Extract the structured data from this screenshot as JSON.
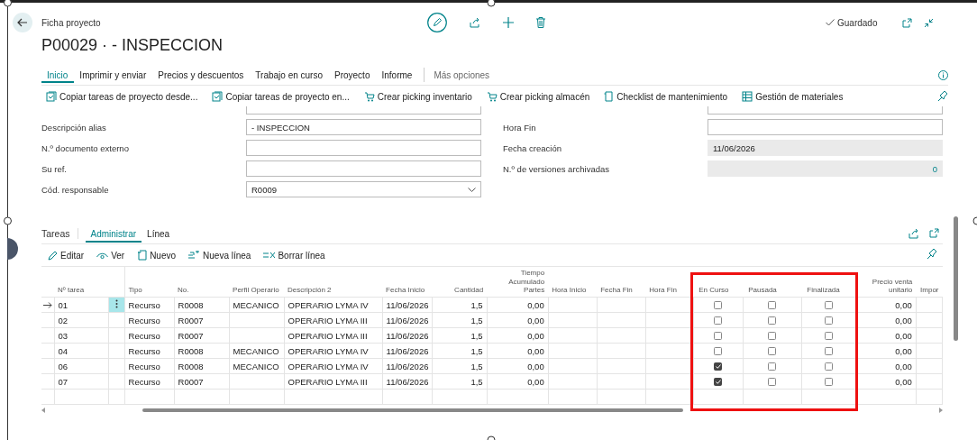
{
  "header": {
    "breadcrumb": "Ficha proyecto",
    "title": "P00029 · - INSPECCION",
    "status": "Guardado"
  },
  "menu": {
    "tabs": [
      {
        "label": "Inicio",
        "selected": true
      },
      {
        "label": "Imprimir y enviar",
        "selected": false
      },
      {
        "label": "Precios y descuentos",
        "selected": false
      },
      {
        "label": "Trabajo en curso",
        "selected": false
      },
      {
        "label": "Proyecto",
        "selected": false
      },
      {
        "label": "Informe",
        "selected": false
      }
    ],
    "more": "Más opciones"
  },
  "actions": [
    {
      "label": "Copiar tareas de proyecto desde...",
      "kind": "copy"
    },
    {
      "label": "Copiar tareas de proyecto en...",
      "kind": "copy"
    },
    {
      "label": "Crear picking inventario",
      "kind": "picking"
    },
    {
      "label": "Crear picking almacén",
      "kind": "picking"
    },
    {
      "label": "Checklist de mantenimiento",
      "kind": "doc"
    },
    {
      "label": "Gestión de materiales",
      "kind": "grid"
    }
  ],
  "fields_left": [
    {
      "label": "Descripción alias",
      "kind": "text",
      "value": "- INSPECCION"
    },
    {
      "label": "N.º documento externo",
      "kind": "text"
    },
    {
      "label": "Su ref.",
      "kind": "text"
    },
    {
      "label": "Cód. responsable",
      "kind": "dropdown",
      "value": "R0009"
    }
  ],
  "fields_right": [
    {
      "label": "Hora Fin",
      "kind": "text"
    },
    {
      "label": "Fecha creación",
      "kind": "readonly",
      "value": "11/06/2026"
    },
    {
      "label": "N.º de versiones archivadas",
      "kind": "readonly-number",
      "value": "0"
    }
  ],
  "tasks": {
    "title": "Tareas",
    "tabs": [
      {
        "label": "Administrar",
        "selected": true
      },
      {
        "label": "Línea",
        "selected": false
      }
    ],
    "actions": [
      {
        "label": "Editar",
        "kind": "edit"
      },
      {
        "label": "Ver",
        "kind": "view"
      },
      {
        "label": "Nuevo",
        "kind": "new"
      },
      {
        "label": "Nueva línea",
        "kind": "newline"
      },
      {
        "label": "Borrar línea",
        "kind": "deleteline"
      }
    ],
    "columns": [
      {
        "label": "Nº tarea",
        "kind": "text",
        "highlighted": false
      },
      {
        "label": "Tipo",
        "kind": "text",
        "highlighted": false
      },
      {
        "label": "No.",
        "kind": "text",
        "highlighted": false
      },
      {
        "label": "Perfil Operario",
        "kind": "text",
        "highlighted": false
      },
      {
        "label": "Descripción 2",
        "kind": "text",
        "highlighted": false
      },
      {
        "label": "Fecha Inicio",
        "kind": "text",
        "highlighted": false
      },
      {
        "label": "Cantidad",
        "kind": "number",
        "highlighted": false
      },
      {
        "label": "Tiempo Acumulado Partes",
        "kind": "number",
        "highlighted": false
      },
      {
        "label": "Hora Inicio",
        "kind": "text",
        "highlighted": false
      },
      {
        "label": "Fecha Fin",
        "kind": "text",
        "highlighted": false
      },
      {
        "label": "Hora Fin",
        "kind": "text",
        "highlighted": false
      },
      {
        "label": "En Curso",
        "kind": "check",
        "highlighted": true
      },
      {
        "label": "Pausada",
        "kind": "check",
        "highlighted": true
      },
      {
        "label": "Finalizada",
        "kind": "check",
        "highlighted": true
      },
      {
        "label": "Precio venta unitario",
        "kind": "number",
        "highlighted": false
      },
      {
        "label": "Impor",
        "kind": "number",
        "highlighted": false
      }
    ],
    "rows": [
      {
        "selected": true,
        "cells": [
          "01",
          "Recurso",
          "R0008",
          "MECANICO",
          "OPERARIO LYMA IV",
          "11/06/2026",
          "1,5",
          "0,00",
          null,
          null,
          null,
          false,
          false,
          false,
          "0,00",
          null
        ]
      },
      {
        "selected": false,
        "cells": [
          "02",
          "Recurso",
          "R0007",
          null,
          "OPERARIO LYMA III",
          "11/06/2026",
          "1,5",
          "0,00",
          null,
          null,
          null,
          false,
          false,
          false,
          "0,00",
          null
        ]
      },
      {
        "selected": false,
        "cells": [
          "03",
          "Recurso",
          "R0007",
          null,
          "OPERARIO LYMA III",
          "11/06/2026",
          "1,5",
          "0,00",
          null,
          null,
          null,
          false,
          false,
          false,
          "0,00",
          null
        ]
      },
      {
        "selected": false,
        "cells": [
          "04",
          "Recurso",
          "R0008",
          "MECANICO",
          "OPERARIO LYMA IV",
          "11/06/2026",
          "1,5",
          "0,00",
          null,
          null,
          null,
          false,
          false,
          false,
          "0,00",
          null
        ]
      },
      {
        "selected": false,
        "cells": [
          "06",
          "Recurso",
          "R0008",
          "MECANICO",
          "OPERARIO LYMA IV",
          "11/06/2026",
          "1,5",
          "0,00",
          null,
          null,
          null,
          true,
          false,
          false,
          "0,00",
          null
        ]
      },
      {
        "selected": false,
        "cells": [
          "07",
          "Recurso",
          "R0007",
          null,
          "OPERARIO LYMA III",
          "11/06/2026",
          "1,5",
          "0,00",
          null,
          null,
          null,
          true,
          false,
          false,
          "0,00",
          null
        ]
      }
    ]
  }
}
